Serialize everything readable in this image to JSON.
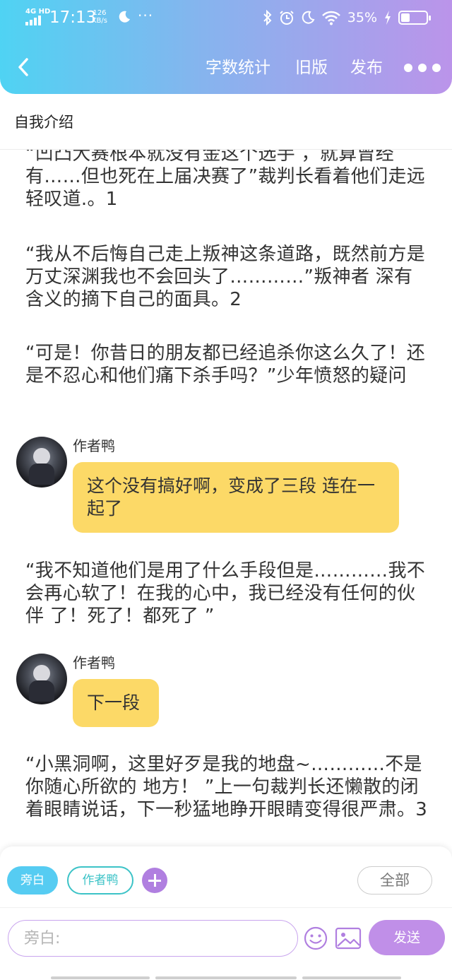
{
  "status_bar": {
    "network": "4G HD",
    "time": "17:13",
    "speed_value": "126",
    "speed_unit": "KB/s",
    "dots": "···",
    "battery_percent": "35%",
    "battery_level": 0.35
  },
  "navbar": {
    "back_icon": "chevron-left-icon",
    "word_count": "字数统计",
    "old_version": "旧版",
    "publish": "发布",
    "more_icon": "more-dots-icon"
  },
  "doc": {
    "title": "自我介绍"
  },
  "messages": [
    {
      "type": "narration",
      "text": "“凹凸大赛根本就没有金这个选手 ，就算曾经有……但也死在上届决赛了”裁判长看着他们走远轻叹道.。1"
    },
    {
      "type": "narration",
      "text": "“我从不后悔自己走上叛神这条道路，既然前方是万丈深渊我也不会回头了…………”叛神者 深有含义的摘下自己的面具。2"
    },
    {
      "type": "narration",
      "text": "“可是！你昔日的朋友都已经追杀你这么久了！还是不忍心和他们痛下杀手吗？”少年愤怒的疑问"
    },
    {
      "type": "author",
      "name": "作者鸭",
      "text": "这个没有搞好啊，变成了三段 连在一起了"
    },
    {
      "type": "narration",
      "text": "“我不知道他们是用了什么手段但是…………我不会再心软了！在我的心中，我已经没有任何的伙伴 了！死了！都死了 ”"
    },
    {
      "type": "author",
      "name": "作者鸭",
      "text": "下一段"
    },
    {
      "type": "narration",
      "text": "“小黑洞啊，这里好歹是我的地盘~…………不是你随心所欲的 地方！ ”上一句裁判长还懒散的闭着眼睛说话，下一秒猛地睁开眼睛变得很严肃。3"
    }
  ],
  "composer": {
    "role_narration": "旁白",
    "role_author": "作者鸭",
    "add_role_icon": "plus-icon",
    "filter_all": "全部",
    "input_placeholder": "旁白:",
    "input_value": "",
    "emoji_icon": "emoji-icon",
    "image_icon": "image-icon",
    "send": "发送"
  },
  "colors": {
    "header_gradient": [
      "#4fd3f3",
      "#86b4ee",
      "#bb94ea"
    ],
    "bubble": "#fcd967",
    "narration_chip": "#56ccf2",
    "author_chip": "#3cc3c7",
    "accent_purple": "#c08fe8"
  }
}
